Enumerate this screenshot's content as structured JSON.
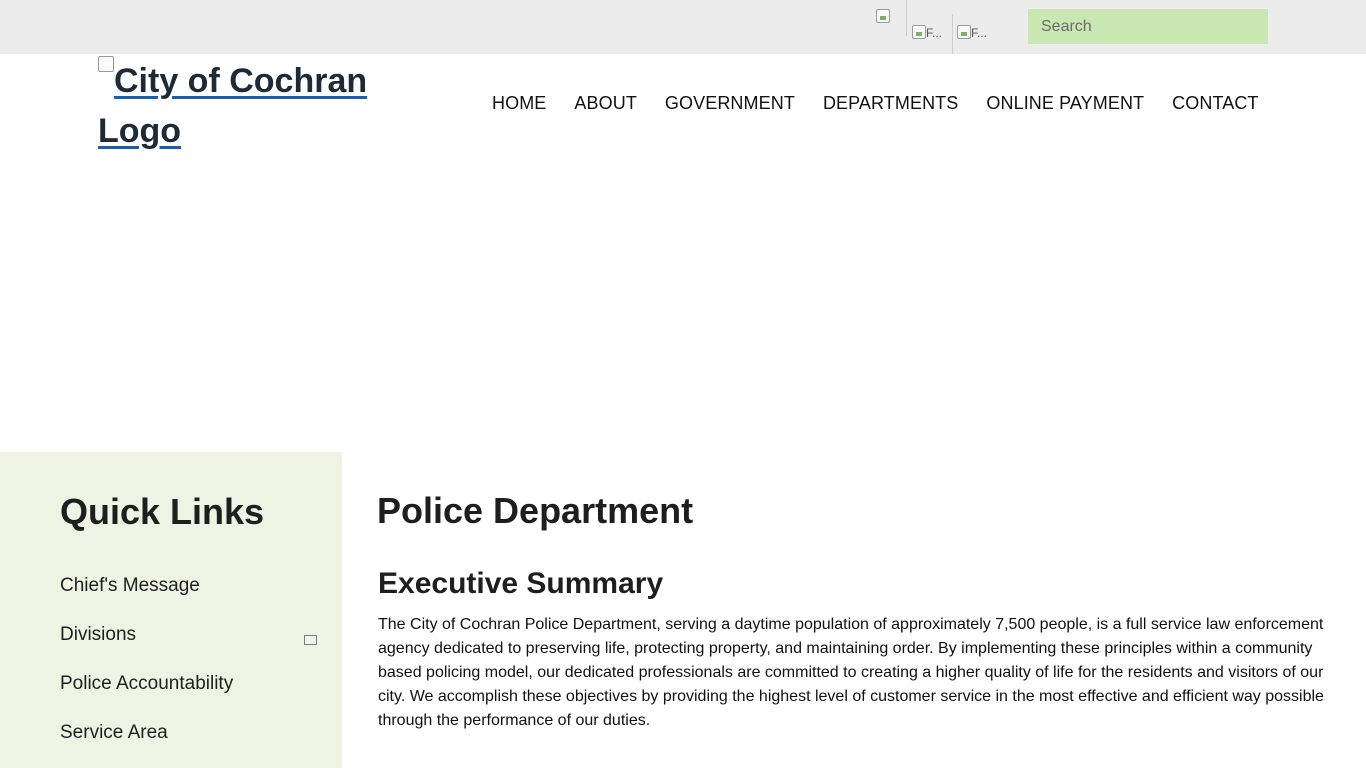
{
  "topbar": {
    "icon_1_alt": "",
    "icon_2_alt": "F...",
    "icon_3_alt": "F...",
    "search_placeholder": "Search"
  },
  "header": {
    "logo_alt": "City of Cochran Logo",
    "nav": [
      "HOME",
      "ABOUT",
      "GOVERNMENT",
      "DEPARTMENTS",
      "ONLINE PAYMENT",
      "CONTACT"
    ]
  },
  "sidebar": {
    "title": "Quick Links",
    "items": [
      {
        "label": "Chief's Message"
      },
      {
        "label": "Divisions"
      },
      {
        "label": "Police Accountability"
      },
      {
        "label": "Service Area"
      }
    ]
  },
  "main": {
    "title": "Police Department",
    "subtitle": "Executive Summary",
    "paragraph": "The City of Cochran Police Department, serving a daytime population of approximately 7,500 people, is a full service law enforcement agency dedicated to preserving life, protecting property, and maintaining order. By implementing these principles within a community based policing model, our dedicated professionals are committed to creating a higher quality of life for the residents and visitors of our city. We accomplish these objectives by providing the highest level of customer service in the most effective and efficient way possible through the performance of our duties."
  },
  "colors": {
    "topbar_bg": "#ececec",
    "search_bg": "#c9e7b2",
    "sidebar_bg": "#eef3e3",
    "logo_underline": "#1c5ea8"
  }
}
